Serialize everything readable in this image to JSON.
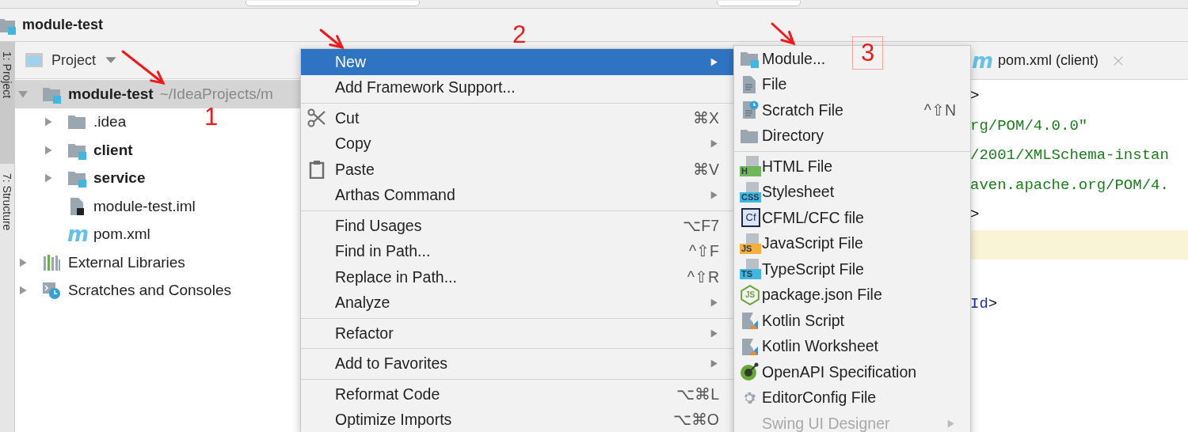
{
  "breadcrumb": {
    "label": "module-test"
  },
  "tool_strip": [
    {
      "label": "1: Project",
      "selected": true
    },
    {
      "label": "7: Structure",
      "selected": false
    }
  ],
  "project_panel": {
    "title": "Project",
    "tree": [
      {
        "label": "module-test",
        "path": "~/IdeaProjects/m",
        "bold": true,
        "kind": "module-folder",
        "expanded": true,
        "selected": true,
        "children": [
          {
            "label": ".idea",
            "bold": false,
            "kind": "folder",
            "expanded": false,
            "selected": false
          },
          {
            "label": "client",
            "bold": true,
            "kind": "module-folder",
            "expanded": false,
            "selected": false
          },
          {
            "label": "service",
            "bold": true,
            "kind": "module-folder",
            "expanded": false,
            "selected": false
          },
          {
            "label": "module-test.iml",
            "bold": false,
            "kind": "iml",
            "selected": false
          },
          {
            "label": "pom.xml",
            "bold": false,
            "kind": "maven",
            "icon_text": "m",
            "selected": false
          }
        ]
      },
      {
        "label": "External Libraries",
        "bold": false,
        "kind": "libraries",
        "expanded": false,
        "selected": false
      },
      {
        "label": "Scratches and Consoles",
        "bold": false,
        "kind": "scratches",
        "expanded": false,
        "selected": false
      }
    ]
  },
  "editor": {
    "tab": {
      "label": "pom.xml (client)",
      "kind": "maven",
      "icon_text": "m"
    },
    "lines": [
      {
        "current": false,
        "segments": [
          {
            "text": ">",
            "kind": "tag"
          }
        ]
      },
      {
        "current": false,
        "segments": [
          {
            "text": "rg/POM/4.0.0\"",
            "kind": "string"
          }
        ]
      },
      {
        "current": false,
        "segments": [
          {
            "text": "/2001/XMLSchema-instan",
            "kind": "string"
          }
        ]
      },
      {
        "current": false,
        "segments": [
          {
            "text": "aven.apache.org/POM/4.",
            "kind": "string"
          }
        ]
      },
      {
        "current": false,
        "segments": [
          {
            "text": ">",
            "kind": "tag"
          }
        ]
      },
      {
        "current": true
      },
      {
        "current": false
      },
      {
        "current": false,
        "segments": [
          {
            "text": "Id",
            "kind": "name"
          },
          {
            "text": ">",
            "kind": "tag"
          }
        ]
      }
    ]
  },
  "context_menu": {
    "items": [
      {
        "kind": "plain",
        "label": "New",
        "selected": true,
        "submenu": true
      },
      {
        "kind": "plain",
        "label": "Add Framework Support...",
        "selected": false,
        "submenu": false
      },
      {
        "kind": "separator"
      },
      {
        "kind": "scissors",
        "label": "Cut",
        "shortcut": "⌘X",
        "selected": false,
        "submenu": false
      },
      {
        "kind": "plain",
        "label": "Copy",
        "selected": false,
        "submenu": true
      },
      {
        "kind": "clipboard",
        "label": "Paste",
        "shortcut": "⌘V",
        "selected": false,
        "submenu": false
      },
      {
        "kind": "plain",
        "label": "Arthas Command",
        "selected": false,
        "submenu": true
      },
      {
        "kind": "separator"
      },
      {
        "kind": "plain",
        "label": "Find Usages",
        "shortcut": "⌥F7",
        "selected": false,
        "submenu": false
      },
      {
        "kind": "plain",
        "label": "Find in Path...",
        "shortcut": "^⇧F",
        "selected": false,
        "submenu": false
      },
      {
        "kind": "plain",
        "label": "Replace in Path...",
        "shortcut": "^⇧R",
        "selected": false,
        "submenu": false
      },
      {
        "kind": "plain",
        "label": "Analyze",
        "selected": false,
        "submenu": true
      },
      {
        "kind": "separator"
      },
      {
        "kind": "plain",
        "label": "Refactor",
        "selected": false,
        "submenu": true
      },
      {
        "kind": "separator"
      },
      {
        "kind": "plain",
        "label": "Add to Favorites",
        "selected": false,
        "submenu": true
      },
      {
        "kind": "separator"
      },
      {
        "kind": "plain",
        "label": "Reformat Code",
        "shortcut": "⌥⌘L",
        "selected": false,
        "submenu": false
      },
      {
        "kind": "plain",
        "label": "Optimize Imports",
        "shortcut": "⌥⌘O",
        "selected": false,
        "submenu": false
      }
    ]
  },
  "submenu": {
    "items": [
      {
        "kind": "module-folder",
        "label": "Module...",
        "selected": false,
        "disabled": false,
        "submenu": false
      },
      {
        "kind": "file",
        "label": "File",
        "selected": false,
        "disabled": false,
        "submenu": false
      },
      {
        "kind": "scratch",
        "label": "Scratch File",
        "shortcut": "^⇧N",
        "selected": false,
        "disabled": false,
        "submenu": false
      },
      {
        "kind": "folder",
        "label": "Directory",
        "selected": false,
        "disabled": false,
        "submenu": false
      },
      {
        "kind": "separator"
      },
      {
        "kind": "html-badge",
        "label": "HTML File",
        "icon_text": "H",
        "selected": false,
        "disabled": false,
        "submenu": false
      },
      {
        "kind": "css-badge",
        "label": "Stylesheet",
        "icon_text": "CSS",
        "selected": false,
        "disabled": false,
        "submenu": false
      },
      {
        "kind": "cf-badge",
        "label": "CFML/CFC file",
        "icon_text": "Cf",
        "selected": false,
        "disabled": false,
        "submenu": false
      },
      {
        "kind": "js-badge",
        "label": "JavaScript File",
        "icon_text": "JS",
        "selected": false,
        "disabled": false,
        "submenu": false
      },
      {
        "kind": "ts-badge",
        "label": "TypeScript File",
        "icon_text": "TS",
        "selected": false,
        "disabled": false,
        "submenu": false
      },
      {
        "kind": "node-badge",
        "label": "package.json File",
        "icon_text": "JS",
        "selected": false,
        "disabled": false,
        "submenu": false
      },
      {
        "kind": "kotlin",
        "label": "Kotlin Script",
        "selected": false,
        "disabled": false,
        "submenu": false
      },
      {
        "kind": "kotlin",
        "label": "Kotlin Worksheet",
        "selected": false,
        "disabled": false,
        "submenu": false
      },
      {
        "kind": "openapi",
        "label": "OpenAPI Specification",
        "selected": false,
        "disabled": false,
        "submenu": false
      },
      {
        "kind": "gear",
        "label": "EditorConfig File",
        "selected": false,
        "disabled": false,
        "submenu": false
      },
      {
        "kind": "plain",
        "label": "Swing UI Designer",
        "selected": false,
        "disabled": true,
        "submenu": true
      }
    ]
  },
  "annotations": [
    {
      "kind": "arrow"
    },
    {
      "kind": "arrow"
    },
    {
      "kind": "arrow"
    },
    {
      "kind": "number",
      "text": "1",
      "boxed": false
    },
    {
      "kind": "number",
      "text": "2",
      "boxed": false
    },
    {
      "kind": "number",
      "text": "3",
      "boxed": true
    }
  ]
}
